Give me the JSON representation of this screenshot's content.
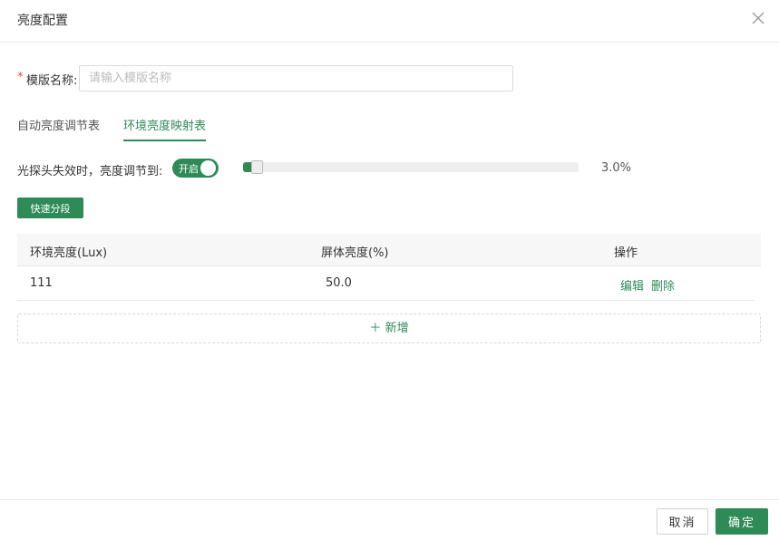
{
  "dialog": {
    "title": "亮度配置",
    "close_icon": "close-icon"
  },
  "form": {
    "required_mark": "*",
    "template_name_label": "模版名称:",
    "template_name_value": "",
    "template_name_placeholder": "请输入模版名称"
  },
  "tabs": [
    {
      "label": "自动亮度调节表",
      "active": false
    },
    {
      "label": "环境亮度映射表",
      "active": true
    }
  ],
  "sensor": {
    "label": "光探头失效时，亮度调节到:",
    "switch_text": "开启",
    "switch_on": true,
    "slider_value": 0.03,
    "value_text": "3.0%"
  },
  "quick_segment_button": "快速分段",
  "table": {
    "columns": [
      "环境亮度(Lux)",
      "屏体亮度(%)",
      "操作"
    ],
    "rows": [
      {
        "ambient": "111",
        "screen": "50.0",
        "edit": "编辑",
        "delete": "删除"
      }
    ]
  },
  "add_row": {
    "icon": "plus-icon",
    "label": "新增"
  },
  "footer": {
    "cancel_label": "取消",
    "ok_label": "确定"
  },
  "colors": {
    "accent": "#2e8b57",
    "required": "#e64545"
  }
}
